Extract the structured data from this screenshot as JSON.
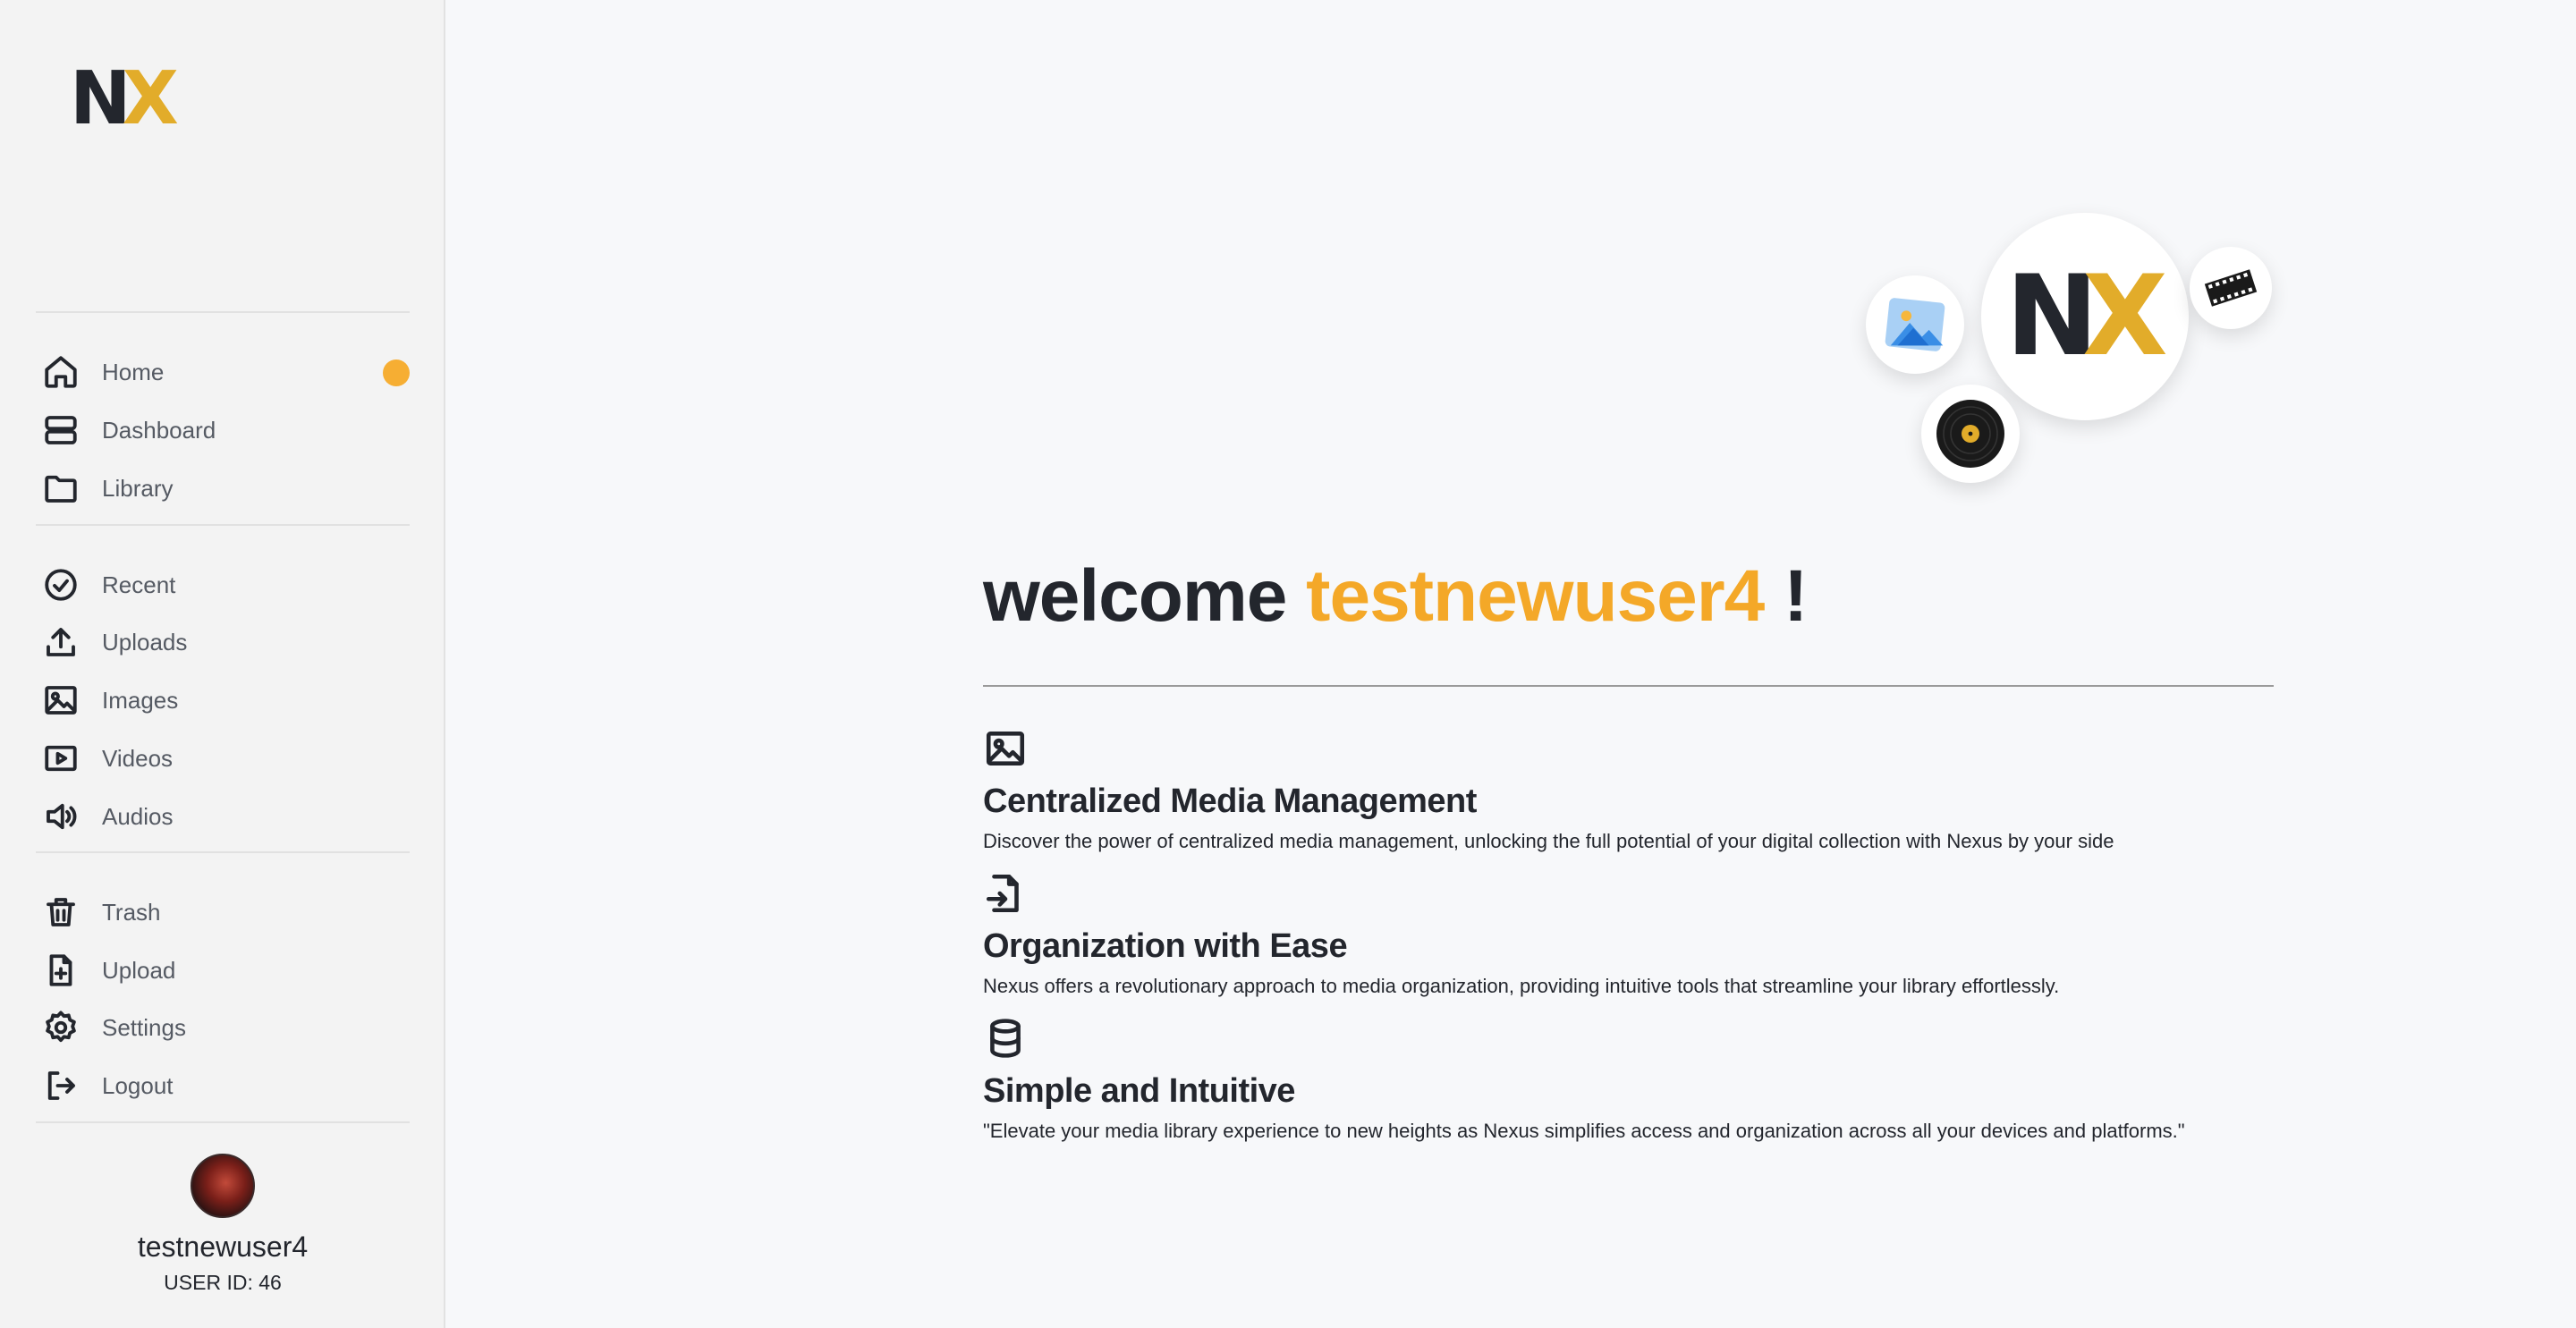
{
  "sidebar": {
    "logo": {
      "n": "N",
      "x": "X"
    },
    "nav": {
      "home": "Home",
      "dashboard": "Dashboard",
      "library": "Library",
      "recent": "Recent",
      "uploads": "Uploads",
      "images": "Images",
      "videos": "Videos",
      "audios": "Audios",
      "trash": "Trash",
      "upload": "Upload",
      "settings": "Settings",
      "logout": "Logout"
    },
    "user": {
      "name": "testnewuser4",
      "id_label": "USER ID: 46"
    }
  },
  "main": {
    "hero_logo": {
      "n": "N",
      "x": "X"
    },
    "welcome": {
      "prefix": "welcome ",
      "username": "testnewuser4",
      "suffix": " !"
    },
    "features": [
      {
        "icon": "image-icon",
        "title": "Centralized Media Management",
        "description": "Discover the power of centralized media management, unlocking the full potential of your digital collection with Nexus by your side"
      },
      {
        "icon": "file-import-icon",
        "title": "Organization with Ease",
        "description": "Nexus offers a revolutionary approach to media organization, providing intuitive tools that streamline your library effortlessly."
      },
      {
        "icon": "database-icon",
        "title": "Simple and Intuitive",
        "description": "\"Elevate your media library experience to new heights as Nexus simplifies access and organization across all your devices and platforms.\""
      }
    ]
  },
  "colors": {
    "accent": "#f4a828",
    "logo_x": "#e2ac2a",
    "notification": "#f6ae33",
    "text": "#23262d"
  }
}
